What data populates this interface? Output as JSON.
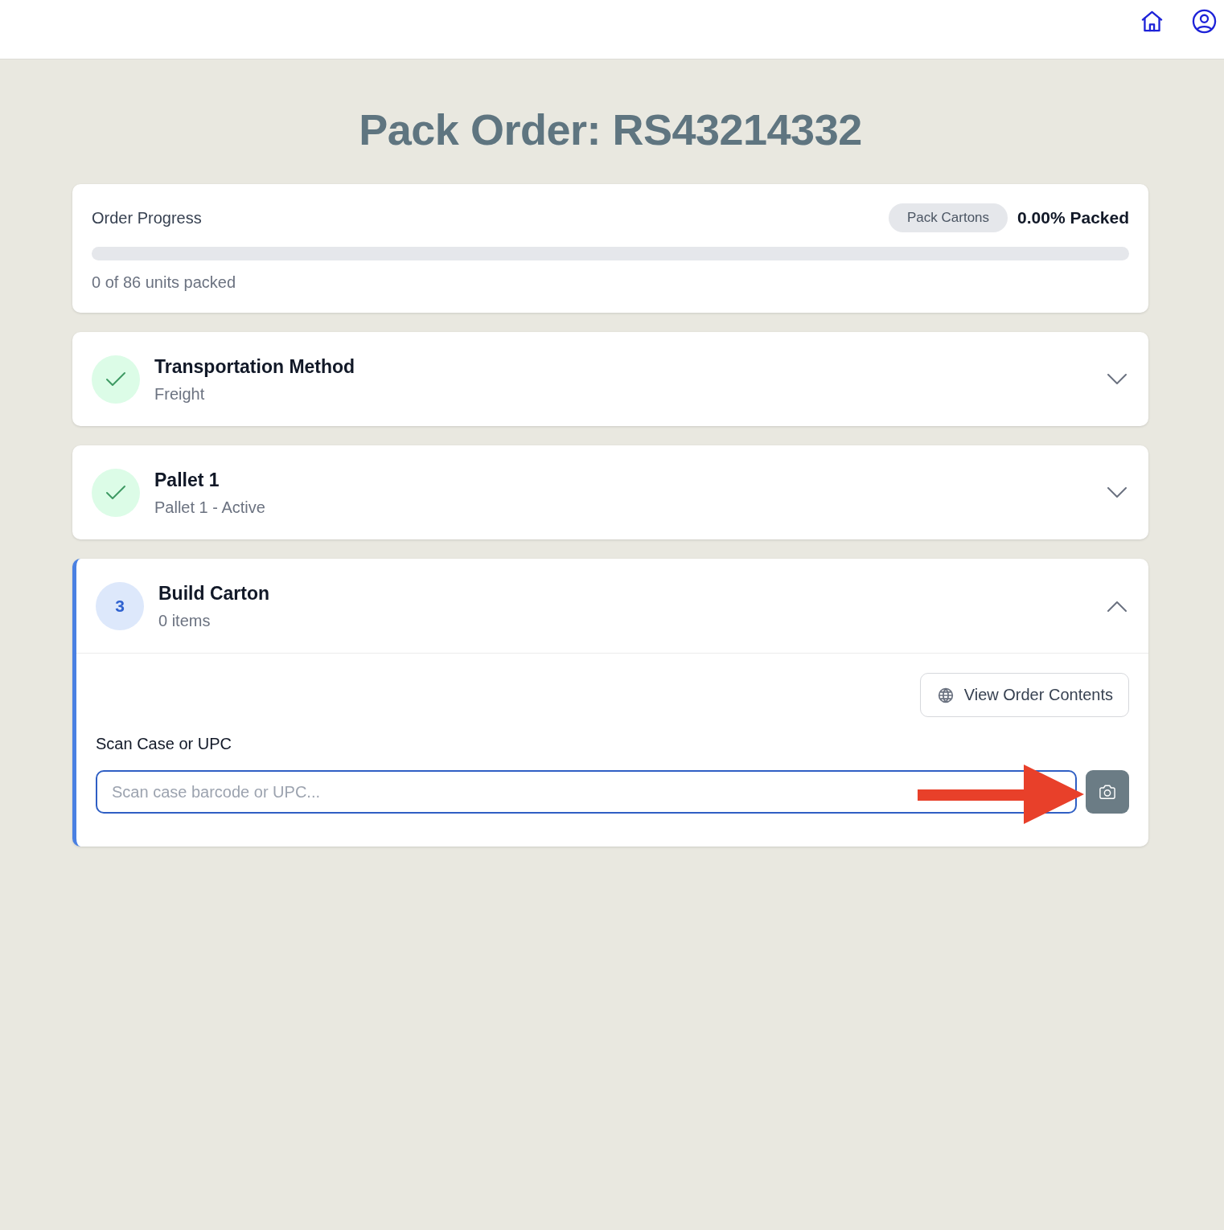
{
  "title": "Pack Order: RS43214332",
  "progress": {
    "label": "Order Progress",
    "badge": "Pack Cartons",
    "percent": "0.00% Packed",
    "level": 0,
    "caption": "0 of 86 units packed"
  },
  "steps": [
    {
      "title": "Transportation Method",
      "subtitle": "Freight",
      "completed": true,
      "expanded": false,
      "active": false
    },
    {
      "title": "Pallet 1",
      "subtitle": "Pallet 1 - Active",
      "completed": true,
      "expanded": false,
      "active": false
    },
    {
      "title": "Build Carton",
      "subtitle": "0 items",
      "completed": false,
      "number": "3",
      "expanded": true,
      "active": true,
      "body": {
        "button": "View Order Contents",
        "field_label": "Scan Case or UPC",
        "placeholder": "Scan case barcode or UPC...",
        "focused": true
      }
    }
  ]
}
